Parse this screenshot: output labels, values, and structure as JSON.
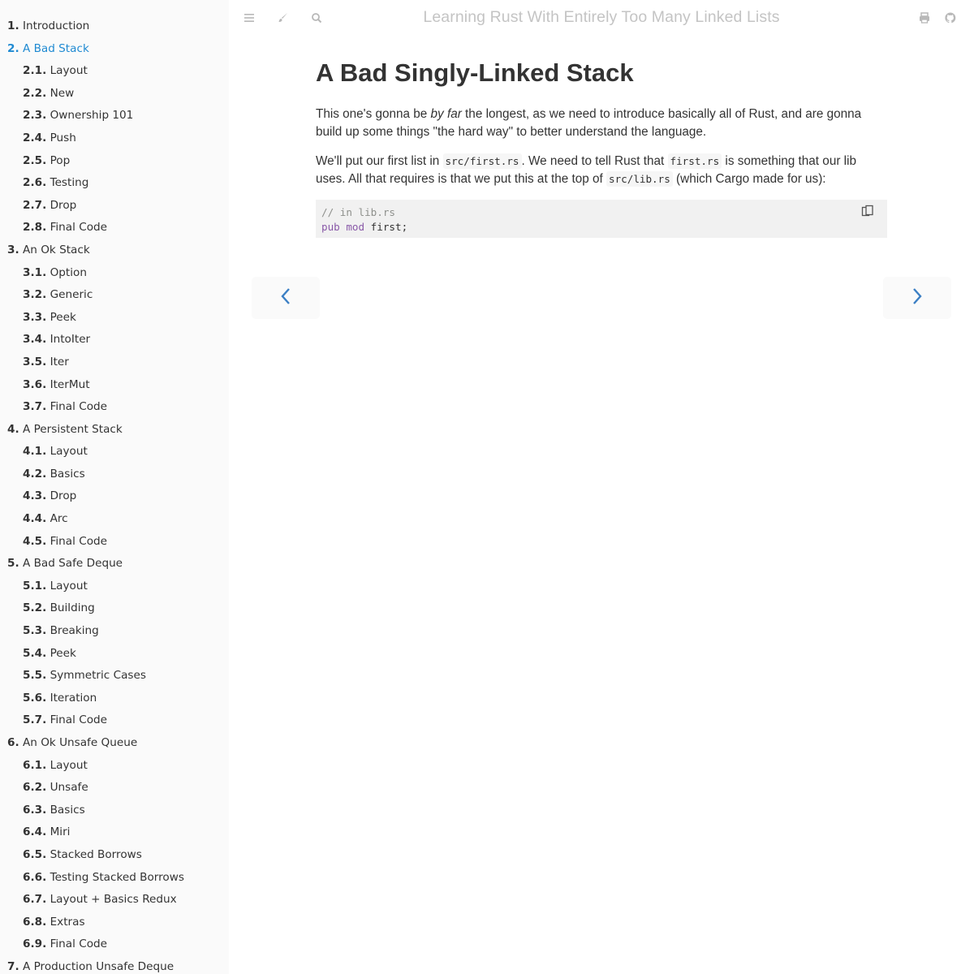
{
  "sidebar": {
    "items": [
      {
        "num": "1.",
        "label": "Introduction",
        "level": 1,
        "active": false
      },
      {
        "num": "2.",
        "label": "A Bad Stack",
        "level": 1,
        "active": true
      },
      {
        "num": "2.1.",
        "label": "Layout",
        "level": 2,
        "active": false
      },
      {
        "num": "2.2.",
        "label": "New",
        "level": 2,
        "active": false
      },
      {
        "num": "2.3.",
        "label": "Ownership 101",
        "level": 2,
        "active": false
      },
      {
        "num": "2.4.",
        "label": "Push",
        "level": 2,
        "active": false
      },
      {
        "num": "2.5.",
        "label": "Pop",
        "level": 2,
        "active": false
      },
      {
        "num": "2.6.",
        "label": "Testing",
        "level": 2,
        "active": false
      },
      {
        "num": "2.7.",
        "label": "Drop",
        "level": 2,
        "active": false
      },
      {
        "num": "2.8.",
        "label": "Final Code",
        "level": 2,
        "active": false
      },
      {
        "num": "3.",
        "label": "An Ok Stack",
        "level": 1,
        "active": false
      },
      {
        "num": "3.1.",
        "label": "Option",
        "level": 2,
        "active": false
      },
      {
        "num": "3.2.",
        "label": "Generic",
        "level": 2,
        "active": false
      },
      {
        "num": "3.3.",
        "label": "Peek",
        "level": 2,
        "active": false
      },
      {
        "num": "3.4.",
        "label": "IntoIter",
        "level": 2,
        "active": false
      },
      {
        "num": "3.5.",
        "label": "Iter",
        "level": 2,
        "active": false
      },
      {
        "num": "3.6.",
        "label": "IterMut",
        "level": 2,
        "active": false
      },
      {
        "num": "3.7.",
        "label": "Final Code",
        "level": 2,
        "active": false
      },
      {
        "num": "4.",
        "label": "A Persistent Stack",
        "level": 1,
        "active": false
      },
      {
        "num": "4.1.",
        "label": "Layout",
        "level": 2,
        "active": false
      },
      {
        "num": "4.2.",
        "label": "Basics",
        "level": 2,
        "active": false
      },
      {
        "num": "4.3.",
        "label": "Drop",
        "level": 2,
        "active": false
      },
      {
        "num": "4.4.",
        "label": "Arc",
        "level": 2,
        "active": false
      },
      {
        "num": "4.5.",
        "label": "Final Code",
        "level": 2,
        "active": false
      },
      {
        "num": "5.",
        "label": "A Bad Safe Deque",
        "level": 1,
        "active": false
      },
      {
        "num": "5.1.",
        "label": "Layout",
        "level": 2,
        "active": false
      },
      {
        "num": "5.2.",
        "label": "Building",
        "level": 2,
        "active": false
      },
      {
        "num": "5.3.",
        "label": "Breaking",
        "level": 2,
        "active": false
      },
      {
        "num": "5.4.",
        "label": "Peek",
        "level": 2,
        "active": false
      },
      {
        "num": "5.5.",
        "label": "Symmetric Cases",
        "level": 2,
        "active": false
      },
      {
        "num": "5.6.",
        "label": "Iteration",
        "level": 2,
        "active": false
      },
      {
        "num": "5.7.",
        "label": "Final Code",
        "level": 2,
        "active": false
      },
      {
        "num": "6.",
        "label": "An Ok Unsafe Queue",
        "level": 1,
        "active": false
      },
      {
        "num": "6.1.",
        "label": "Layout",
        "level": 2,
        "active": false
      },
      {
        "num": "6.2.",
        "label": "Unsafe",
        "level": 2,
        "active": false
      },
      {
        "num": "6.3.",
        "label": "Basics",
        "level": 2,
        "active": false
      },
      {
        "num": "6.4.",
        "label": "Miri",
        "level": 2,
        "active": false
      },
      {
        "num": "6.5.",
        "label": "Stacked Borrows",
        "level": 2,
        "active": false
      },
      {
        "num": "6.6.",
        "label": "Testing Stacked Borrows",
        "level": 2,
        "active": false
      },
      {
        "num": "6.7.",
        "label": "Layout + Basics Redux",
        "level": 2,
        "active": false
      },
      {
        "num": "6.8.",
        "label": "Extras",
        "level": 2,
        "active": false
      },
      {
        "num": "6.9.",
        "label": "Final Code",
        "level": 2,
        "active": false
      },
      {
        "num": "7.",
        "label": "A Production Unsafe Deque",
        "level": 1,
        "active": false
      }
    ]
  },
  "menu_bar": {
    "title": "Learning Rust With Entirely Too Many Linked Lists",
    "left_icons": [
      "hamburger-menu-icon",
      "paintbrush-icon",
      "search-icon"
    ],
    "right_icons": [
      "print-icon",
      "github-icon"
    ]
  },
  "content": {
    "title": "A Bad Singly-Linked Stack",
    "p1": {
      "before": "This one's gonna be ",
      "em": "by far",
      "after": " the longest, as we need to introduce basically all of Rust, and are gonna build up some things \"the hard way\" to better understand the language."
    },
    "p2": {
      "t1": "We'll put our first list in ",
      "c1": "src/first.rs",
      "t2": ". We need to tell Rust that ",
      "c2": "first.rs",
      "t3": " is something that our lib uses. All that requires is that we put this at the top of ",
      "c3": "src/lib.rs",
      "t4": " (which Cargo made for us):"
    },
    "code": {
      "comment": "// in lib.rs",
      "kw1": "pub",
      "kw2": "mod",
      "rest": " first;"
    }
  },
  "nav": {
    "prev_icon": "chevron-left-icon",
    "next_icon": "chevron-right-icon"
  },
  "colors": {
    "active_link": "#1f8ad2",
    "nav_arrow": "#3b7fc4",
    "keyword": "#8959a8"
  }
}
